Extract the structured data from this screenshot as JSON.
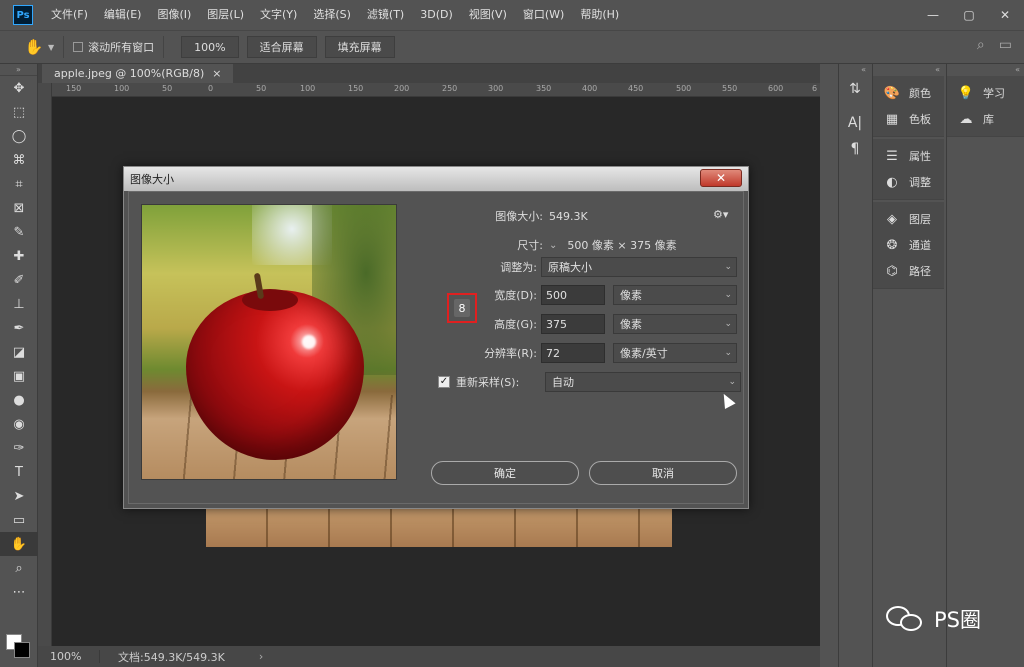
{
  "app": {
    "logo": "Ps"
  },
  "menu": [
    "文件(F)",
    "编辑(E)",
    "图像(I)",
    "图层(L)",
    "文字(Y)",
    "选择(S)",
    "滤镜(T)",
    "3D(D)",
    "视图(V)",
    "窗口(W)",
    "帮助(H)"
  ],
  "options": {
    "scroll_all_label": "滚动所有窗口",
    "zoom_btn": "100%",
    "fit_screen": "适合屏幕",
    "fill_screen": "填充屏幕"
  },
  "document": {
    "tab_label": "apple.jpeg @ 100%(RGB/8)",
    "tab_close": "×",
    "ruler_ticks": [
      "150",
      "100",
      "50",
      "0",
      "50",
      "100",
      "150",
      "200",
      "250",
      "300",
      "350",
      "400",
      "450",
      "500",
      "550",
      "600",
      "6"
    ]
  },
  "status": {
    "zoom": "100%",
    "doc_info": "文档:549.3K/549.3K",
    "arrow": "›"
  },
  "dialog": {
    "title": "图像大小",
    "close": "✕",
    "image_size_label": "图像大小:",
    "image_size_value": "549.3K",
    "dimensions_label": "尺寸:",
    "dimensions_value": "500 像素 × 375 像素",
    "fit_to_label": "调整为:",
    "fit_to_value": "原稿大小",
    "width_label": "宽度(D):",
    "width_value": "500",
    "width_unit": "像素",
    "height_label": "高度(G):",
    "height_value": "375",
    "height_unit": "像素",
    "resolution_label": "分辨率(R):",
    "resolution_value": "72",
    "resolution_unit": "像素/英寸",
    "resample_label": "重新采样(S):",
    "resample_value": "自动",
    "resample_checked": true,
    "ok_label": "确定",
    "cancel_label": "取消"
  },
  "panels": {
    "group1": [
      "颜色",
      "色板"
    ],
    "group2": [
      "属性",
      "调整"
    ],
    "group3": [
      "图层",
      "通道",
      "路径"
    ],
    "group4": [
      "学习",
      "库"
    ]
  },
  "watermark": "PS圈"
}
